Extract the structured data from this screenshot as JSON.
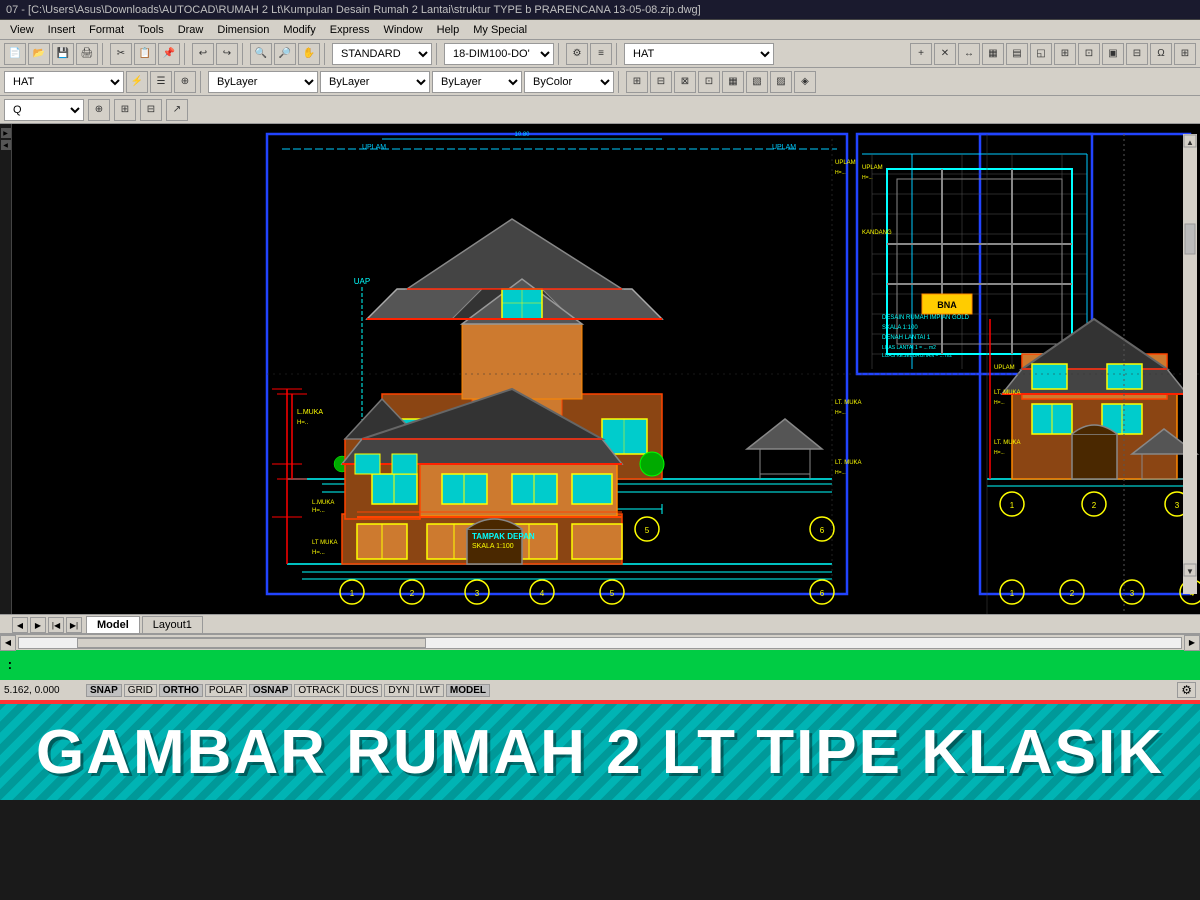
{
  "titlebar": {
    "text": "07 - [C:\\Users\\Asus\\Downloads\\AUTOCAD\\RUMAH 2 Lt\\Kumpulan Desain Rumah 2 Lantai\\struktur TYPE b PRARENCANA 13-05-08.zip.dwg]"
  },
  "menubar": {
    "items": [
      "View",
      "Insert",
      "Format",
      "Tools",
      "Draw",
      "Dimension",
      "Modify",
      "Express",
      "Window",
      "Help",
      "My Special"
    ]
  },
  "toolbar1": {
    "layer_dropdown": "HAT",
    "standard_dropdown": "STANDARD",
    "dim_dropdown": "18-DIM100-DO'",
    "hat_dropdown": "HAT"
  },
  "toolbar2": {
    "layer_dropdown": "HAT",
    "bylayer1": "ByLayer",
    "bylayer2": "ByLayer",
    "bylayer3": "ByLayer",
    "bycolor": "ByColor"
  },
  "tabs": {
    "items": [
      "Model",
      "Layout1"
    ],
    "active": "Model"
  },
  "command_line": {
    "text": ":"
  },
  "status_bar": {
    "coords": "5.162, 0.000",
    "items": [
      "SNAP",
      "GRID",
      "ORTHO",
      "POLAR",
      "OSNAP",
      "OTRACK",
      "DUCS",
      "DYN",
      "LWT",
      "MODEL"
    ]
  },
  "big_title": {
    "text": "GAMBAR RUMAH 2 LT TIPE KLASIK"
  }
}
